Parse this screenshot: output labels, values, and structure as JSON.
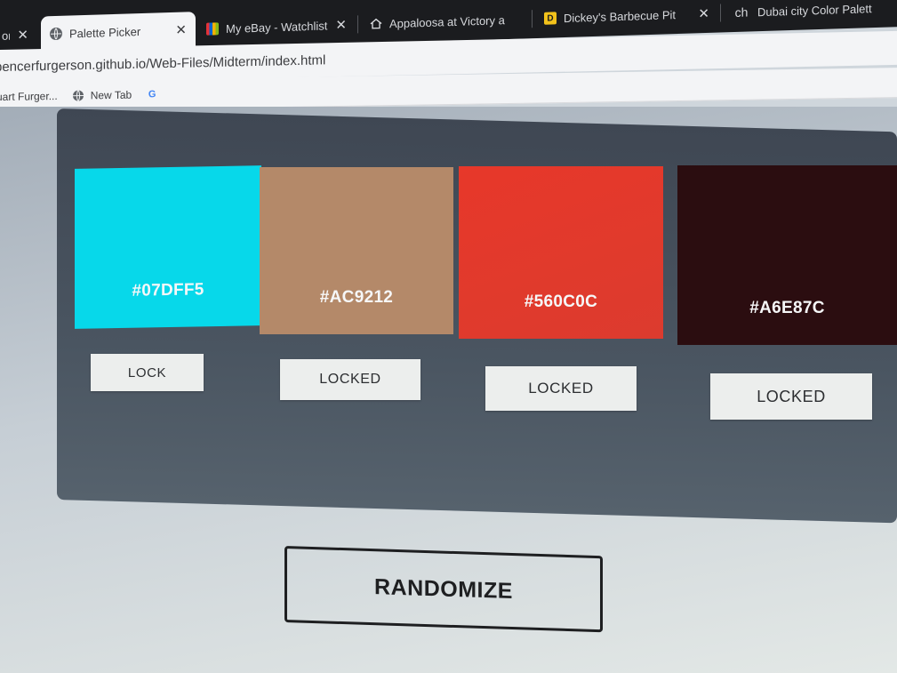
{
  "browser": {
    "tabs": [
      {
        "title": "ome",
        "icon": "page-icon",
        "active": false
      },
      {
        "title": "Palette Picker",
        "icon": "globe-icon",
        "active": true
      },
      {
        "title": "My eBay - Watchlist",
        "icon": "shopping-bag-icon",
        "active": false
      },
      {
        "title": "Appaloosa at Victory a",
        "icon": "home-icon",
        "active": false
      },
      {
        "title": "Dickey's Barbecue Pit",
        "icon": "dickeys-logo-icon",
        "active": false
      },
      {
        "title": "Dubai city Color Palett",
        "icon": "ch-logo-icon",
        "icon_text": "ch",
        "active": false
      }
    ],
    "close_glyph": "✕",
    "url": "pencerfurgerson.github.io/Web-Files/Midterm/index.html",
    "bookmarks": [
      {
        "label": "uart Furger...",
        "icon": "none"
      },
      {
        "label": "New Tab",
        "icon": "globe-icon"
      },
      {
        "label": "",
        "icon": "google-icon",
        "icon_text": "G"
      }
    ],
    "dickeys_icon_text": "D"
  },
  "palette": {
    "swatches": [
      {
        "hex_label": "#07DFF5",
        "color": "#07d8ea",
        "button_label": "LOCK"
      },
      {
        "hex_label": "#AC9212",
        "color": "#b48969",
        "button_label": "LOCKED"
      },
      {
        "hex_label": "#560C0C",
        "color": "#e43a2a",
        "button_label": "LOCKED"
      },
      {
        "hex_label": "#A6E87C",
        "color": "#2b0d10",
        "button_label": "LOCKED"
      }
    ]
  },
  "actions": {
    "randomize_label": "RANDOMIZE"
  }
}
